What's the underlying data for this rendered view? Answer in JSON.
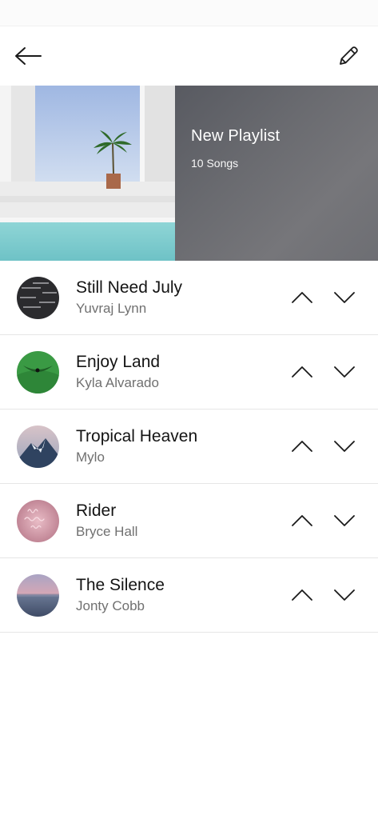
{
  "header": {
    "back_icon": "arrow-left-icon",
    "edit_icon": "pencil-icon"
  },
  "playlist": {
    "title": "New Playlist",
    "count": "10 Songs"
  },
  "songs": [
    {
      "title": "Still Need July",
      "artist": "Yuvraj Lynn",
      "thumb_colors": [
        "#2b2b2e",
        "#5a5a5e"
      ]
    },
    {
      "title": "Enjoy Land",
      "artist": "Kyla Alvarado",
      "thumb_colors": [
        "#2f8a3a",
        "#58b25a"
      ]
    },
    {
      "title": "Tropical Heaven",
      "artist": "Mylo",
      "thumb_colors": [
        "#c7b2b8",
        "#2f4360"
      ]
    },
    {
      "title": "Rider",
      "artist": "Bryce Hall",
      "thumb_colors": [
        "#c98f9f",
        "#e6b4bf"
      ]
    },
    {
      "title": "The Silence",
      "artist": "Jonty Cobb",
      "thumb_colors": [
        "#b9a3b9",
        "#4e5e7a"
      ]
    }
  ],
  "colors": {
    "accent_text": "#141414",
    "secondary_text": "#707070",
    "divider": "#e6e6e6"
  }
}
